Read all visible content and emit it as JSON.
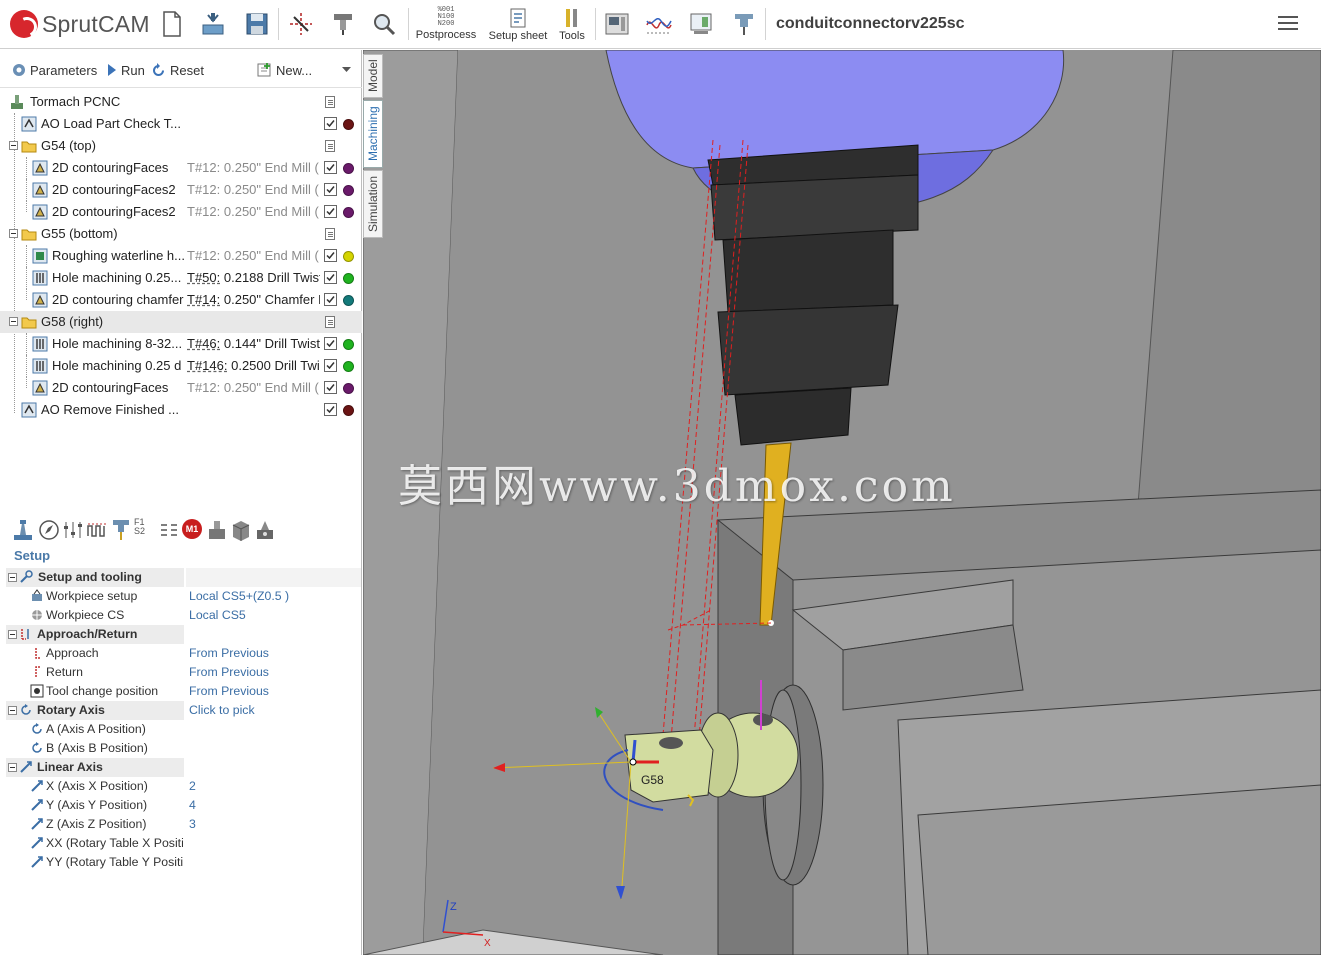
{
  "app": {
    "name": "SprutCAM",
    "file_name": "conduitconnectorv225sc"
  },
  "toolbar": {
    "postprocess_label": "Postprocess",
    "setup_sheet_label": "Setup sheet",
    "tools_label": "Tools",
    "postprocess_icon_text": [
      "%001",
      "N100",
      "N200"
    ]
  },
  "ops_toolbar": {
    "parameters_label": "Parameters",
    "run_label": "Run",
    "reset_label": "Reset",
    "new_label": "New..."
  },
  "side_tabs": [
    "Model",
    "Machining",
    "Simulation"
  ],
  "tree": {
    "machine": "Tormach PCNC",
    "rows": [
      {
        "name": "AO Load Part Check T...",
        "tool_no": "",
        "tool_desc": "",
        "dot": "#6b1414"
      },
      {
        "name": "G54 (top)",
        "folder": true
      },
      {
        "name": "2D contouringFaces",
        "tool_no": "T#12:",
        "tool_desc": "0.250\" End Mill (",
        "dot": "#6a1a6a"
      },
      {
        "name": "2D contouringFaces2",
        "tool_no": "T#12:",
        "tool_desc": "0.250\" End Mill (",
        "dot": "#6a1a6a"
      },
      {
        "name": "2D contouringFaces2",
        "tool_no": "T#12:",
        "tool_desc": "0.250\" End Mill (",
        "dot": "#6a1a6a"
      },
      {
        "name": "G55 (bottom)",
        "folder": true
      },
      {
        "name": "Roughing waterline h...",
        "tool_no": "T#12:",
        "tool_desc": "0.250\" End Mill (",
        "dot": "#d4d400"
      },
      {
        "name": "Hole machining 0.25...",
        "tool_no": "T#50:",
        "tool_desc": "0.2188 Drill Twist",
        "dot": "#1fb31f"
      },
      {
        "name": "2D contouring chamfer",
        "tool_no": "T#14:",
        "tool_desc": "0.250\" Chamfer M",
        "dot": "#137a7a"
      },
      {
        "name": "G58 (right)",
        "folder": true
      },
      {
        "name": "Hole machining 8-32...",
        "tool_no": "T#46:",
        "tool_desc": "0.144\" Drill Twist",
        "dot": "#1fb31f"
      },
      {
        "name": "Hole machining 0.25 d",
        "tool_no": "T#146:",
        "tool_desc": "0.2500 Drill Twi",
        "dot": "#1fb31f"
      },
      {
        "name": "2D contouringFaces",
        "tool_no": "T#12:",
        "tool_desc": "0.250\" End Mill (",
        "dot": "#6a1a6a"
      },
      {
        "name": "AO Remove Finished ...",
        "tool_no": "",
        "tool_desc": "",
        "dot": "#6b1414"
      }
    ]
  },
  "properties": {
    "panel_title": "Setup",
    "m1_badge": "M1",
    "f1s2": [
      "F1",
      "S2"
    ],
    "groups": {
      "setup_tooling": "Setup and tooling",
      "approach_return": "Approach/Return",
      "rotary_axis": "Rotary Axis",
      "linear_axis": "Linear Axis"
    },
    "items": {
      "workpiece_setup": {
        "name": "Workpiece setup",
        "value": "Local CS5+(Z0.5 )"
      },
      "workpiece_cs": {
        "name": "Workpiece CS",
        "value": "Local CS5"
      },
      "approach": {
        "name": "Approach",
        "value": "From Previous"
      },
      "return": {
        "name": "Return",
        "value": "From Previous"
      },
      "tool_change": {
        "name": "Tool change position",
        "value": "From Previous"
      },
      "rotary_value": "Click to pick",
      "a_axis": {
        "name": "A (Axis A Position)",
        "value": ""
      },
      "b_axis": {
        "name": "B (Axis B Position)",
        "value": ""
      },
      "x_axis": {
        "name": "X (Axis X Position)",
        "value": "2"
      },
      "y_axis": {
        "name": "Y (Axis Y Position)",
        "value": "4"
      },
      "z_axis": {
        "name": "Z (Axis Z Position)",
        "value": "3"
      },
      "xx_axis": {
        "name": "XX (Rotary Table X Positio",
        "value": ""
      },
      "yy_axis": {
        "name": "YY (Rotary Table Y Positio",
        "value": ""
      }
    }
  },
  "viewport": {
    "watermark": "莫西网www.3dmox.com",
    "cs_label": "G58",
    "axis_z": "Z",
    "axis_x": "X",
    "colors": {
      "spindle_blue": "#8c8cf2",
      "tool_gold": "#e0b020",
      "part_green": "#d2dca0",
      "toolpath_red": "#e02020"
    }
  }
}
